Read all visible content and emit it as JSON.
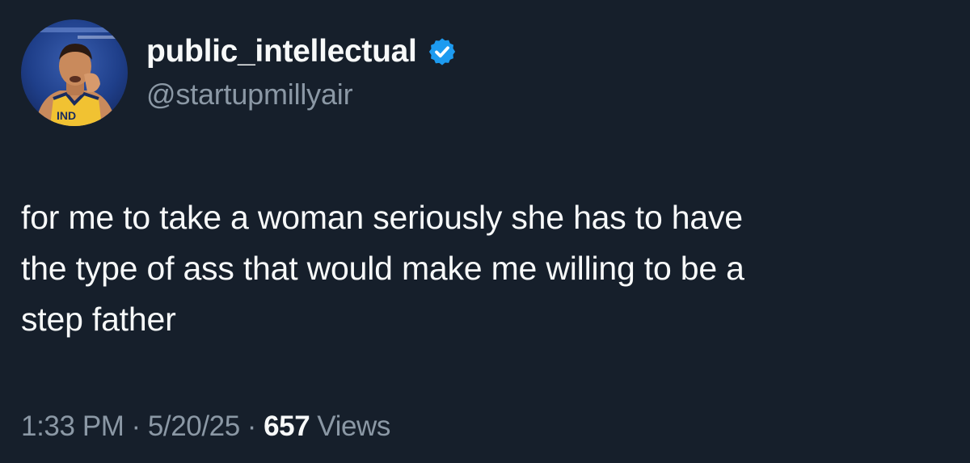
{
  "author": {
    "display_name": "public_intellectual",
    "handle": "@startupmillyair",
    "verified": true,
    "avatar_icon": "profile-photo-basketball-player"
  },
  "tweet": {
    "text": "for me to take a woman seriously she has to have\nthe type of ass that would make me willing to be a\nstep father"
  },
  "meta": {
    "time": "1:33 PM",
    "date": "5/20/25",
    "separator": "·",
    "views_count": "657",
    "views_label": "Views"
  },
  "colors": {
    "background": "#161f2b",
    "primary_text": "#f7f9f9",
    "secondary_text": "#8b98a5",
    "verified_badge": "#1d9bf0"
  }
}
